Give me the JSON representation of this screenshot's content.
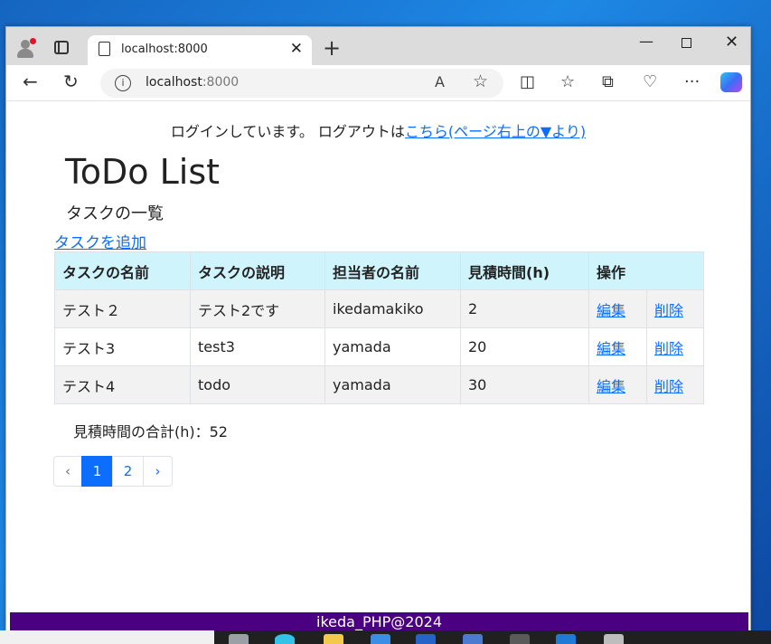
{
  "browser": {
    "tab_title": "localhost:8000",
    "url_host": "localhost",
    "url_port": ":8000",
    "reader_label": "A",
    "info_label": "i"
  },
  "page": {
    "login_message": "ログインしています。 ログアウトは",
    "logout_link": "こちら(ページ右上の▼より)",
    "title": "ToDo List",
    "subtitle": "タスクの一覧",
    "add_task_link": "タスクを追加",
    "table": {
      "headers": [
        "タスクの名前",
        "タスクの説明",
        "担当者の名前",
        "見積時間(h)",
        "操作"
      ],
      "rows": [
        {
          "name": "テスト２",
          "description": "テスト2です",
          "assignee": "ikedamakiko",
          "estimate": "2",
          "edit": "編集",
          "delete": "削除"
        },
        {
          "name": "テスト3",
          "description": "test3",
          "assignee": "yamada",
          "estimate": "20",
          "edit": "編集",
          "delete": "削除"
        },
        {
          "name": "テスト4",
          "description": "todo",
          "assignee": "yamada",
          "estimate": "30",
          "edit": "編集",
          "delete": "削除"
        }
      ]
    },
    "total_estimate": "見積時間の合計(h)：52",
    "pagination": {
      "prev": "‹",
      "pages": [
        "1",
        "2"
      ],
      "active": "1",
      "next": "›"
    },
    "footer": "ikeda_PHP@2024"
  },
  "colors": {
    "link": "#0d6efd",
    "table_header_bg": "#cff4fc",
    "footer_bg": "#4b0082",
    "active_page_bg": "#0d6efd"
  },
  "icons": [
    "profile-icon",
    "tab-actions-icon",
    "document-icon",
    "close-icon",
    "new-tab-icon",
    "back-icon",
    "reload-icon",
    "info-icon",
    "read-aloud-icon",
    "favorite-star-icon",
    "split-screen-icon",
    "favorites-icon",
    "collections-icon",
    "browser-essentials-icon",
    "more-icon",
    "copilot-icon"
  ]
}
